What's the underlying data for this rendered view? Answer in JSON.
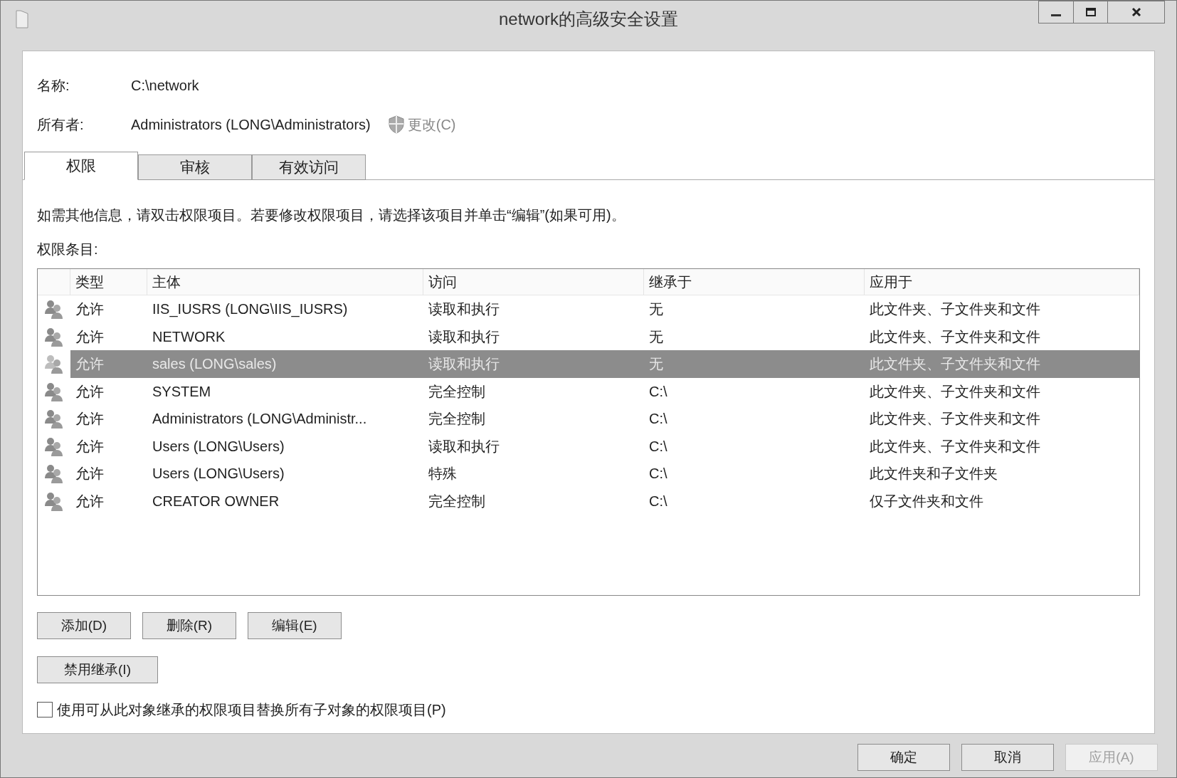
{
  "window": {
    "title": "network的高级安全设置"
  },
  "name": {
    "label": "名称:",
    "value": "C:\\network"
  },
  "owner": {
    "label": "所有者:",
    "value": "Administrators (LONG\\Administrators)",
    "change": "更改(C)"
  },
  "tabs": [
    {
      "label": "权限",
      "selected": true
    },
    {
      "label": "审核",
      "selected": false
    },
    {
      "label": "有效访问",
      "selected": false
    }
  ],
  "info": "如需其他信息，请双击权限项目。若要修改权限项目，请选择该项目并单击“编辑”(如果可用)。",
  "entries_label": "权限条目:",
  "table": {
    "columns": [
      "类型",
      "主体",
      "访问",
      "继承于",
      "应用于"
    ],
    "rows": [
      {
        "cells": [
          "允许",
          "IIS_IUSRS (LONG\\IIS_IUSRS)",
          "读取和执行",
          "无",
          "此文件夹、子文件夹和文件"
        ],
        "selected": false
      },
      {
        "cells": [
          "允许",
          "NETWORK",
          "读取和执行",
          "无",
          "此文件夹、子文件夹和文件"
        ],
        "selected": false
      },
      {
        "cells": [
          "允许",
          "sales (LONG\\sales)",
          "读取和执行",
          "无",
          "此文件夹、子文件夹和文件"
        ],
        "selected": true
      },
      {
        "cells": [
          "允许",
          "SYSTEM",
          "完全控制",
          "C:\\",
          "此文件夹、子文件夹和文件"
        ],
        "selected": false
      },
      {
        "cells": [
          "允许",
          "Administrators (LONG\\Administr...",
          "完全控制",
          "C:\\",
          "此文件夹、子文件夹和文件"
        ],
        "selected": false
      },
      {
        "cells": [
          "允许",
          "Users (LONG\\Users)",
          "读取和执行",
          "C:\\",
          "此文件夹、子文件夹和文件"
        ],
        "selected": false
      },
      {
        "cells": [
          "允许",
          "Users (LONG\\Users)",
          "特殊",
          "C:\\",
          "此文件夹和子文件夹"
        ],
        "selected": false
      },
      {
        "cells": [
          "允许",
          "CREATOR OWNER",
          "完全控制",
          "C:\\",
          "仅子文件夹和文件"
        ],
        "selected": false
      }
    ]
  },
  "entry_buttons": [
    "添加(D)",
    "删除(R)",
    "编辑(E)"
  ],
  "disable_inheritance": "禁用继承(I)",
  "replace_checkbox": {
    "label": "使用可从此对象继承的权限项目替换所有子对象的权限项目(P)",
    "checked": false
  },
  "dialog_buttons": [
    {
      "label": "确定",
      "disabled": false
    },
    {
      "label": "取消",
      "disabled": false
    },
    {
      "label": "应用(A)",
      "disabled": true
    }
  ]
}
